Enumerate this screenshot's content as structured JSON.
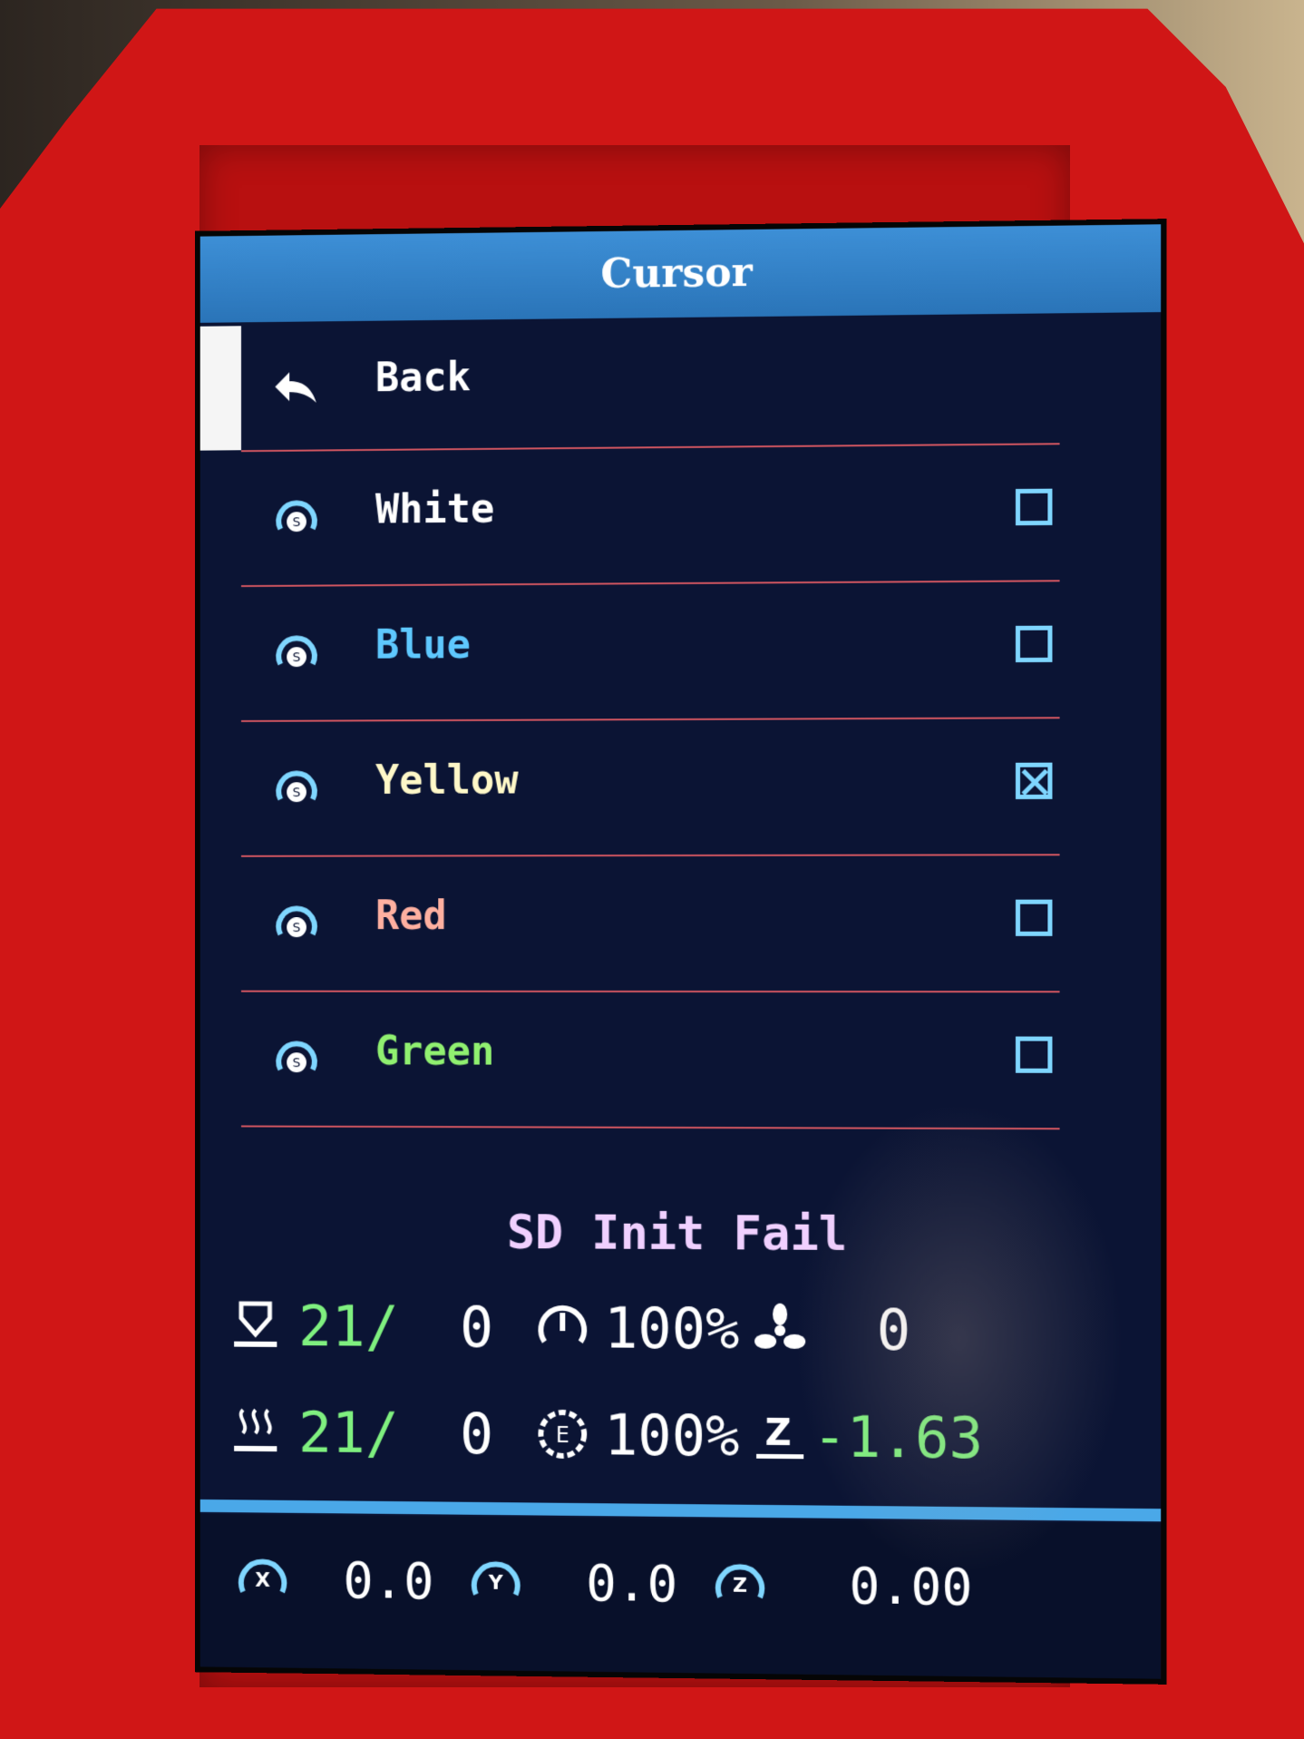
{
  "title": "Cursor",
  "menu": {
    "back_label": "Back",
    "items": [
      {
        "label": "White",
        "color": "#ffffff",
        "checked": false
      },
      {
        "label": "Blue",
        "color": "#5ec8ff",
        "checked": false
      },
      {
        "label": "Yellow",
        "color": "#fff8c8",
        "checked": true
      },
      {
        "label": "Red",
        "color": "#ffb0a0",
        "checked": false
      },
      {
        "label": "Green",
        "color": "#90f070",
        "checked": false
      }
    ]
  },
  "status_message": "SD Init Fail",
  "temps": {
    "bed": {
      "current": "21/",
      "target": "0"
    },
    "nozzle": {
      "current": "21/",
      "target": "0"
    }
  },
  "speed": {
    "value": "100%"
  },
  "flow": {
    "value": "100%"
  },
  "fan": {
    "value": "0"
  },
  "z_offset": {
    "value": "-1.63"
  },
  "coords": {
    "x": "0.0",
    "y": "0.0",
    "z": "0.00"
  },
  "colors": {
    "accent": "#3d8fd6",
    "divider": "#d05560",
    "checkbox": "#7fd6ff"
  }
}
